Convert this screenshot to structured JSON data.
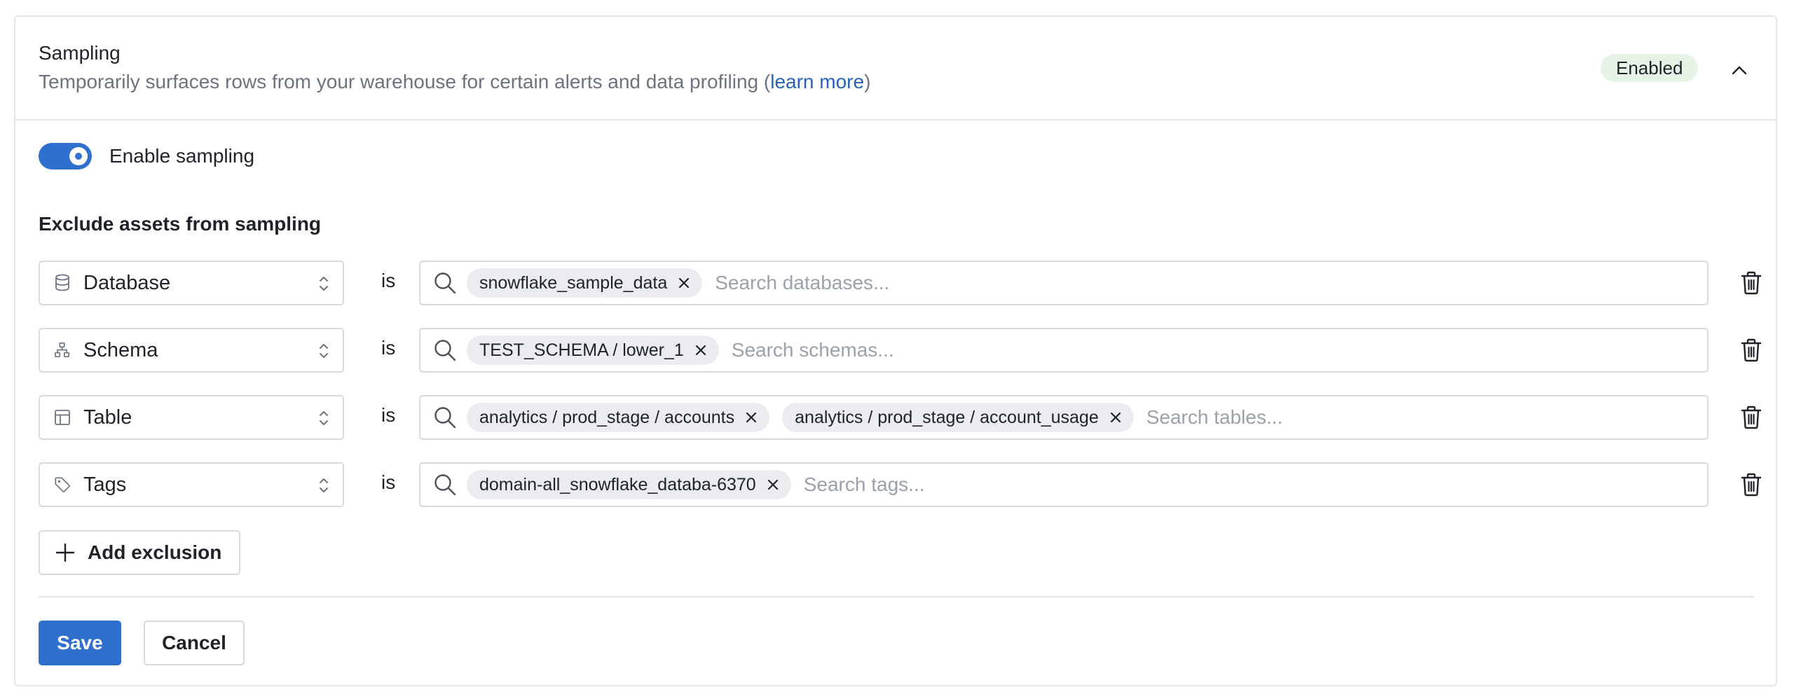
{
  "header": {
    "title": "Sampling",
    "description": "Temporarily surfaces rows from your warehouse for certain alerts and data profiling (",
    "link_text": "learn more",
    "description_end": ")",
    "status_badge": "Enabled",
    "collapse_icon": "chevron-up-icon"
  },
  "toggle": {
    "label": "Enable sampling",
    "checked": true
  },
  "exclusions": {
    "title": "Exclude assets from sampling",
    "operator_label": "is",
    "rows": [
      {
        "type_label": "Database",
        "type_icon": "database-icon",
        "chips": [
          "snowflake_sample_data"
        ],
        "placeholder": "Search databases..."
      },
      {
        "type_label": "Schema",
        "type_icon": "schema-icon",
        "chips": [
          "TEST_SCHEMA / lower_1"
        ],
        "placeholder": "Search schemas..."
      },
      {
        "type_label": "Table",
        "type_icon": "table-icon",
        "chips": [
          "analytics / prod_stage / accounts",
          "analytics / prod_stage / account_usage"
        ],
        "placeholder": "Search tables..."
      },
      {
        "type_label": "Tags",
        "type_icon": "tag-icon",
        "chips": [
          "domain-all_snowflake_databa-6370"
        ],
        "placeholder": "Search tags..."
      }
    ],
    "add_label": "Add exclusion"
  },
  "actions": {
    "save_label": "Save",
    "cancel_label": "Cancel"
  },
  "colors": {
    "accent": "#2f6fce",
    "badge_bg": "#e5f4e6",
    "link": "#2563b8"
  }
}
